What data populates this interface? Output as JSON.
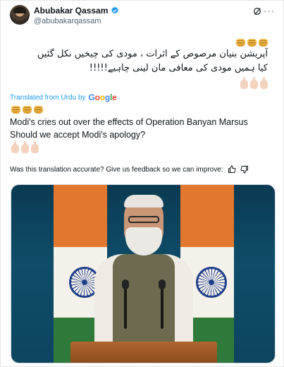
{
  "author": {
    "name": "Abubakar Qassam",
    "handle": "@abubakarqassam",
    "verified": true
  },
  "post": {
    "urdu_line1": "آپریشن بنیان مرصوص کے اثرات ، مودی کی چیخیں نکل گئیں",
    "urdu_line2": "کیا ہمیں مودی کی معافی مان لینی چاہیے!!!!!",
    "translated_label": "Translated from Urdu by",
    "translation_provider": "Google",
    "en_line1": "Modi's cries out over the effects of Operation Banyan Marsus",
    "en_line2": "Should we accept Modi's apology?"
  },
  "feedback": {
    "prompt": "Was this translation accurate? Give us feedback so we can improve:"
  },
  "emoji": {
    "fists_top": [
      "fist",
      "fist",
      "fist"
    ],
    "hands_top": [
      "backhand-index-down",
      "backhand-index-down",
      "backhand-index-down"
    ],
    "fists_en": [
      "fist",
      "fist",
      "fist"
    ],
    "hands_en": [
      "backhand-index-down",
      "backhand-index-down",
      "backhand-index-down"
    ]
  },
  "colors": {
    "link": "#1d9bf0",
    "secondary_text": "#536471",
    "verified": "#1d9bf0"
  },
  "icons": {
    "verified": "verified-badge-icon",
    "grok": "grok-icon",
    "more": "more-icon",
    "thumbs_up": "thumbs-up-icon",
    "thumbs_down": "thumbs-down-icon"
  }
}
